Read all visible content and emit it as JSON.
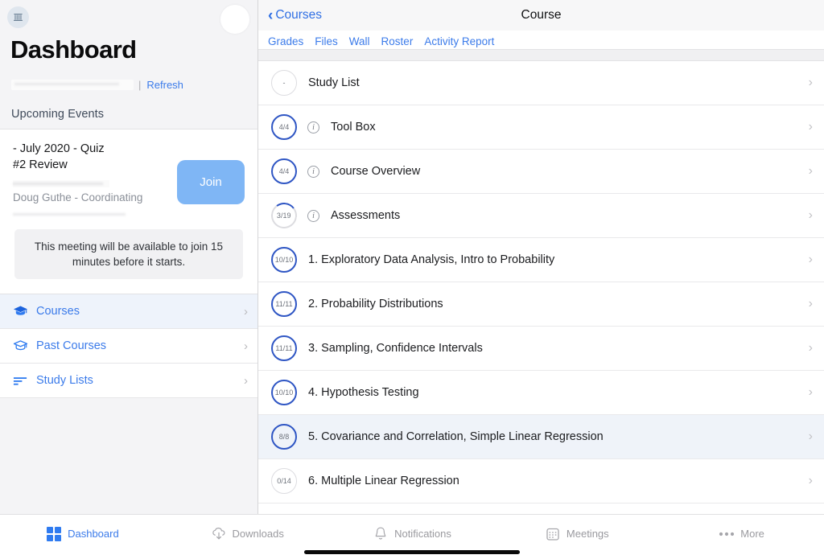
{
  "sidebar": {
    "org_logo_icon": "bank-building-icon",
    "avatar_icon": "user-avatar",
    "title": "Dashboard",
    "account_separator": "|",
    "refresh_label": "Refresh",
    "upcoming_events_header": "Upcoming Events",
    "event": {
      "title": "- July 2020 - Quiz\n#2 Review",
      "host": "Doug Guthe - Coordinating",
      "join_label": "Join",
      "note": "This meeting will be available to join 15 minutes before it starts."
    },
    "nav_items": [
      {
        "label": "Courses",
        "icon": "graduation-cap-filled-icon",
        "chevron": "›",
        "active": true
      },
      {
        "label": "Past Courses",
        "icon": "graduation-cap-outline-icon",
        "chevron": "›",
        "active": false
      },
      {
        "label": "Study Lists",
        "icon": "list-lines-icon",
        "chevron": "›",
        "active": false
      }
    ]
  },
  "main": {
    "back_label": "Courses",
    "back_icon": "chevron-left-icon",
    "title": "Course",
    "tabs": [
      {
        "label": "Grades"
      },
      {
        "label": "Files"
      },
      {
        "label": "Wall"
      },
      {
        "label": "Roster"
      },
      {
        "label": "Activity Report"
      }
    ],
    "rows": [
      {
        "badge": "-",
        "ring": "empty",
        "info": false,
        "label": "Study List",
        "chevron": "›",
        "selected": false
      },
      {
        "badge": "4/4",
        "ring": "full",
        "info": true,
        "label": "Tool Box",
        "chevron": "›",
        "selected": false
      },
      {
        "badge": "4/4",
        "ring": "full",
        "info": true,
        "label": "Course Overview",
        "chevron": "›",
        "selected": false
      },
      {
        "badge": "3/19",
        "ring": "partial",
        "info": true,
        "label": "Assessments",
        "chevron": "›",
        "selected": false
      },
      {
        "badge": "10/10",
        "ring": "full",
        "info": false,
        "label": "1. Exploratory Data Analysis, Intro to Probability",
        "chevron": "›",
        "selected": false
      },
      {
        "badge": "11/11",
        "ring": "full",
        "info": false,
        "label": "2. Probability Distributions",
        "chevron": "›",
        "selected": false
      },
      {
        "badge": "11/11",
        "ring": "full",
        "info": false,
        "label": "3. Sampling, Confidence Intervals",
        "chevron": "›",
        "selected": false
      },
      {
        "badge": "10/10",
        "ring": "full",
        "info": false,
        "label": "4. Hypothesis Testing",
        "chevron": "›",
        "selected": false
      },
      {
        "badge": "8/8",
        "ring": "full",
        "info": false,
        "label": "5. Covariance and Correlation, Simple Linear Regression",
        "chevron": "›",
        "selected": true
      },
      {
        "badge": "0/14",
        "ring": "empty",
        "info": false,
        "label": "6. Multiple Linear Regression",
        "chevron": "›",
        "selected": false
      }
    ]
  },
  "bottom_tabs": [
    {
      "label": "Dashboard",
      "icon": "grid-squares-icon",
      "active": true
    },
    {
      "label": "Downloads",
      "icon": "cloud-download-icon",
      "active": false
    },
    {
      "label": "Notifications",
      "icon": "bell-icon",
      "active": false
    },
    {
      "label": "Meetings",
      "icon": "calendar-icon",
      "active": false
    },
    {
      "label": "More",
      "icon": "ellipsis-icon",
      "active": false
    }
  ],
  "colors": {
    "accent_blue": "#3b7bea",
    "ring_blue": "#2f56c4",
    "join_blue": "#7fb6f5",
    "sidebar_bg": "#f4f4f6",
    "selected_row": "#eff3f9"
  }
}
